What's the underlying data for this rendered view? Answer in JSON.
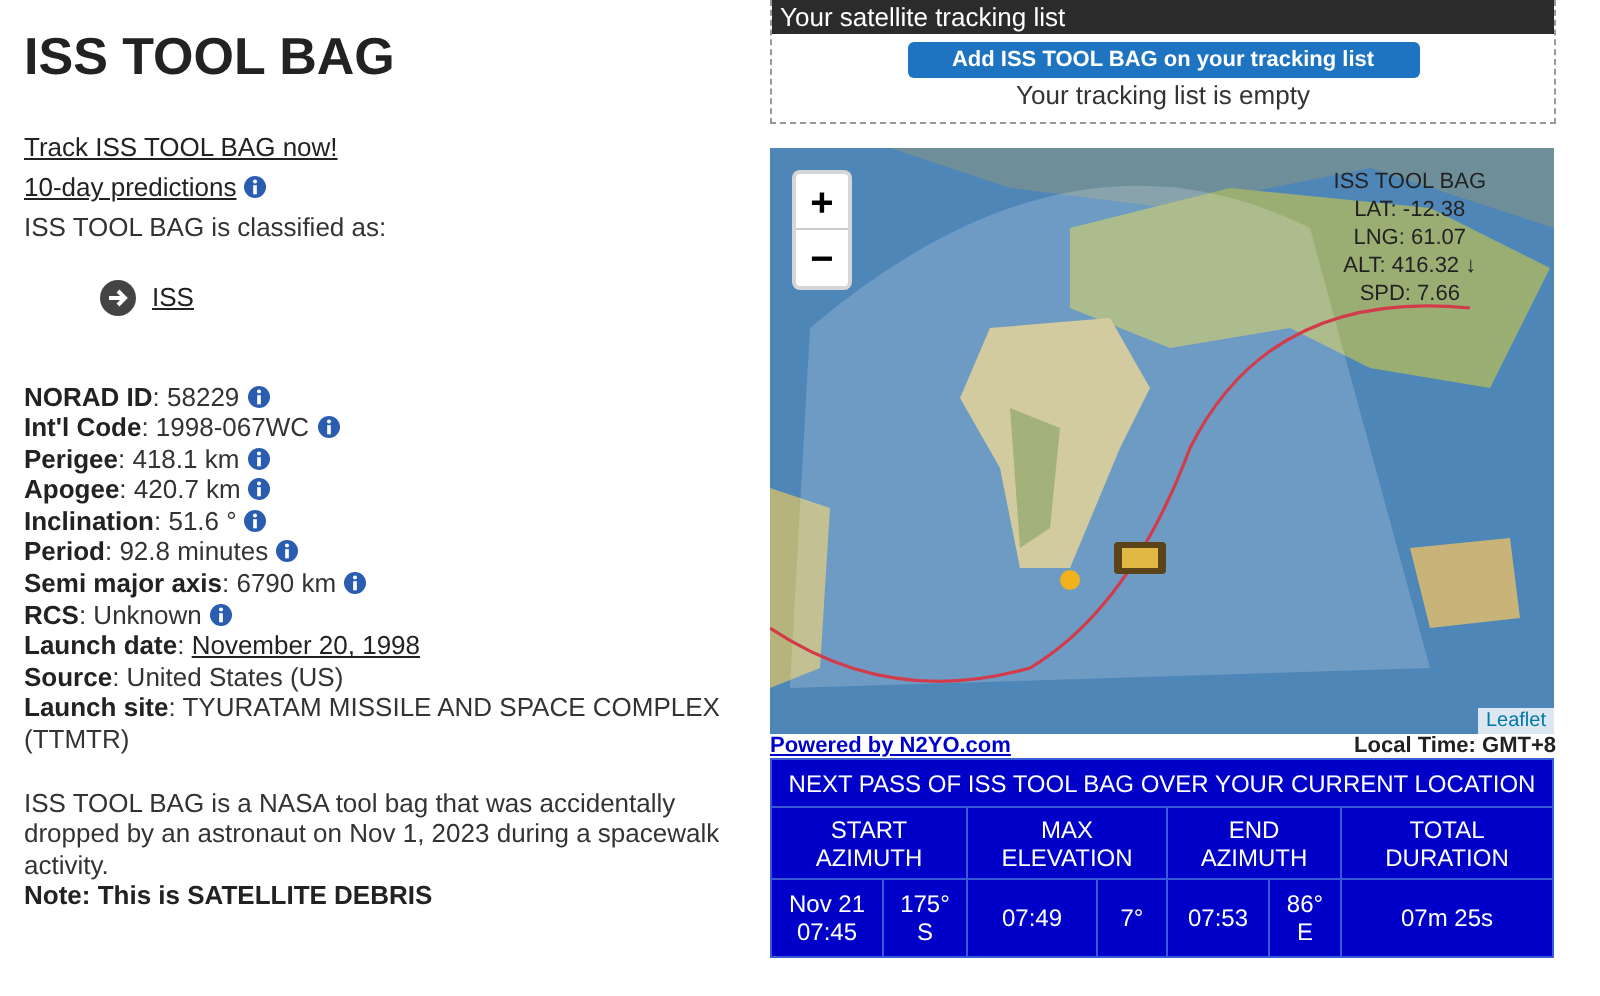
{
  "title": "ISS TOOL BAG",
  "links": [
    {
      "text": "Track ISS TOOL BAG now!",
      "info": false
    },
    {
      "text": "10-day predictions",
      "info": true
    }
  ],
  "classified_text": "ISS TOOL BAG is classified as:",
  "categories": [
    "ISS"
  ],
  "details": [
    {
      "text": "**NORAD ID**: 58229",
      "kind": "text",
      "info": true
    },
    {
      "text": "**Int'l Code**: 1998-067WC",
      "kind": "text",
      "info": true
    },
    {
      "text": "**Perigee**: 418.1 km",
      "kind": "text",
      "info": true
    },
    {
      "text": "**Apogee**: 420.7 km",
      "kind": "text",
      "info": true
    },
    {
      "text": "**Inclination**: 51.6 °",
      "kind": "text",
      "info": true
    },
    {
      "text": "**Period**: 92.8 minutes",
      "kind": "text",
      "info": true
    },
    {
      "text": "**Semi major axis**: 6790 km",
      "kind": "text",
      "info": true
    },
    {
      "text": "**RCS**: Unknown",
      "kind": "text",
      "info": true
    },
    {
      "text": "**Launch date**:",
      "link": "November 20, 1998",
      "kind": "link",
      "info": false
    },
    {
      "text": "**Source**: United States (US)",
      "kind": "text",
      "info": false
    },
    {
      "text": "**Launch site**: TYURATAM MISSILE AND SPACE COMPLEX (TTMTR)",
      "kind": "text",
      "info": false
    }
  ],
  "description": "ISS TOOL BAG is a NASA tool bag that was accidentally dropped by an astronaut on Nov 1, 2023 during a spacewalk activity.",
  "note": "Note: This is SATELLITE DEBRIS",
  "tracking": {
    "header": "Your satellite tracking list",
    "button": "Add ISS TOOL BAG on your tracking list",
    "status": "Your tracking list is empty"
  },
  "map": {
    "zoom_in": "+",
    "zoom_out": "−",
    "overlay": [
      "ISS TOOL BAG",
      "LAT: -12.38",
      "LNG: 61.07",
      "ALT: 416.32 ↓",
      "SPD: 7.66"
    ],
    "attribution": "Leaflet"
  },
  "powered_by": "Powered by N2YO.com",
  "local_time": "Local Time: GMT+8",
  "pass": {
    "title": "NEXT PASS OF ISS TOOL BAG OVER YOUR CURRENT LOCATION",
    "headers": [
      "START\nAZIMUTH",
      "MAX\nELEVATION",
      "END\nAZIMUTH",
      "TOTAL\nDURATION"
    ],
    "cells": [
      "Nov 21\n07:45",
      "175°\nS",
      "07:49",
      "7°",
      "07:53",
      "86°\nE",
      "07m 25s"
    ]
  }
}
